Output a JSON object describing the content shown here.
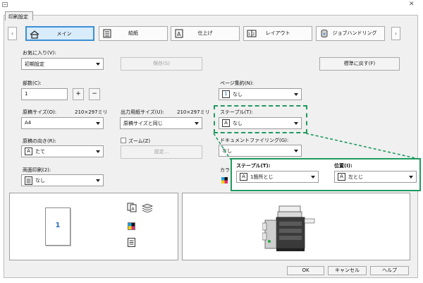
{
  "tab": {
    "label": "印刷設定"
  },
  "nav": {
    "tabs": [
      {
        "label": "メイン",
        "icon": "home-icon"
      },
      {
        "label": "給紙",
        "icon": "paper-feed-icon"
      },
      {
        "label": "仕上げ",
        "icon": "finishing-icon"
      },
      {
        "label": "レイアウト",
        "icon": "layout-icon"
      },
      {
        "label": "ジョブハンドリング",
        "icon": "job-handling-icon"
      }
    ],
    "prev": "‹",
    "next": "›"
  },
  "favorites": {
    "label": "お気に入り(V):",
    "value": "初期設定",
    "save_label": "保存(S)",
    "reset_label": "標準に戻す(F)"
  },
  "copies": {
    "label": "部数(C):",
    "value": "1",
    "plus": "+",
    "minus": "−"
  },
  "original_size": {
    "label": "原稿サイズ(O):",
    "dims": "210×297ミリ",
    "value": "A4"
  },
  "output_size": {
    "label": "出力用紙サイズ(U):",
    "dims": "210×297ミリ",
    "value": "原稿サイズと同じ"
  },
  "orientation": {
    "label": "原稿の向き(R):",
    "icon_letter": "A",
    "value": "たて"
  },
  "zoom": {
    "label": "ズーム(Z)",
    "settings_label": "設定..."
  },
  "duplex": {
    "label": "両面印刷(2):",
    "value": "なし"
  },
  "pages_per_sheet": {
    "label": "ページ集約(N):",
    "icon_text": "1",
    "value": "なし"
  },
  "staple": {
    "label": "ステープル(T):",
    "icon_letter": "A",
    "value": "なし"
  },
  "doc_filing": {
    "label": "ドキュメントファイリング(G):",
    "value": "なし"
  },
  "color_label": "カラ",
  "popup": {
    "staple_label": "ステープル(T):",
    "staple_icon_letter": "A",
    "staple_value": "1箇所とじ",
    "position_label": "位置(I):",
    "position_icon_letter": "A",
    "position_value": "左とじ"
  },
  "preview": {
    "page_number": "1"
  },
  "footer": {
    "ok": "OK",
    "cancel": "キャンセル",
    "help": "ヘルプ"
  },
  "window": {
    "close": "✕"
  },
  "colors": {
    "accent": "#3b8fd6",
    "highlight": "#1f9a5e",
    "page_number": "#2a6fbd"
  }
}
